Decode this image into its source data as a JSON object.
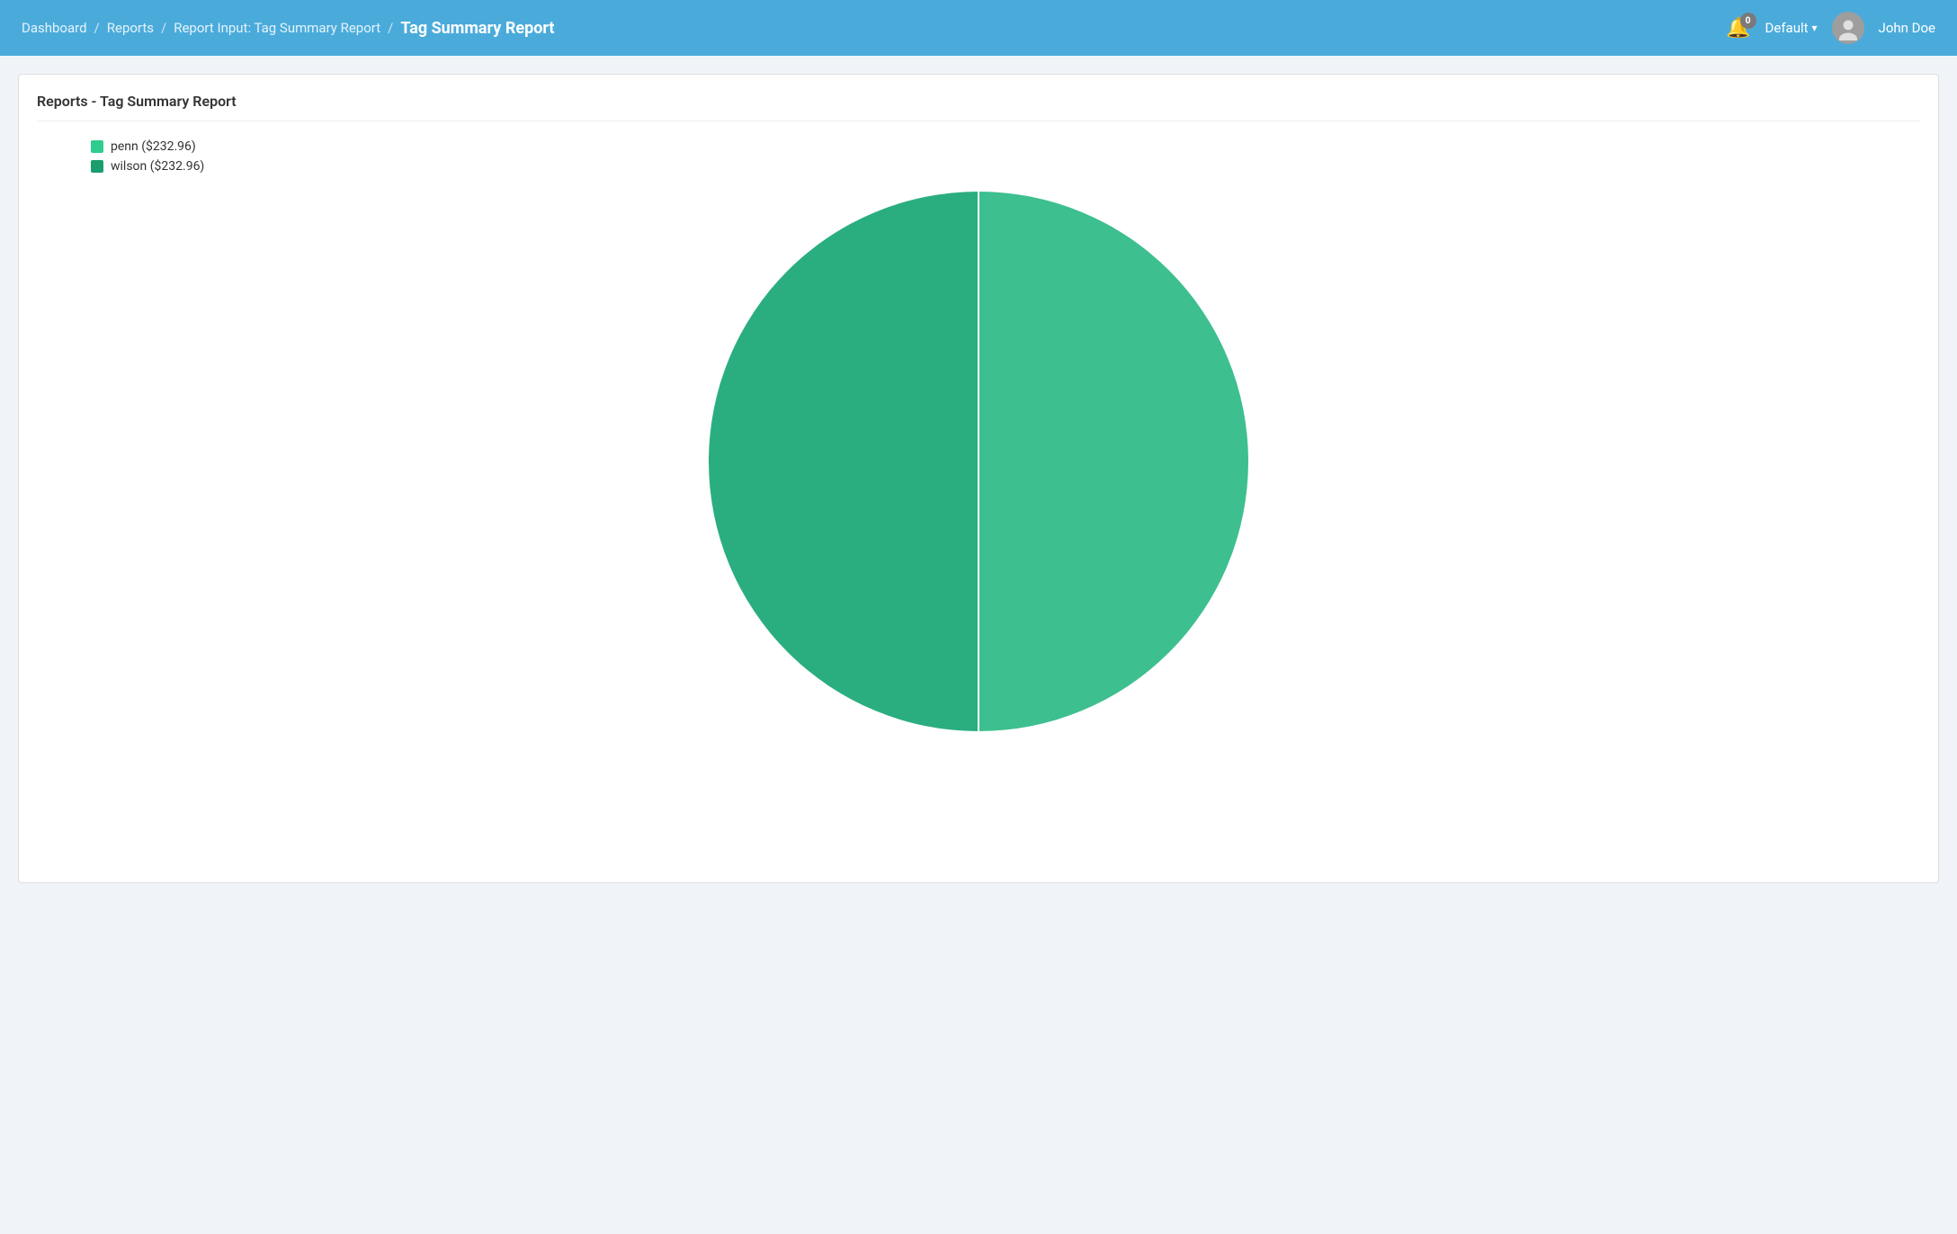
{
  "header": {
    "breadcrumb": [
      {
        "label": "Dashboard",
        "link": true
      },
      {
        "label": "Reports",
        "link": true
      },
      {
        "label": "Report Input: Tag Summary Report",
        "link": true
      }
    ],
    "current_page": "Tag Summary Report",
    "notification_count": "0",
    "dropdown_label": "Default",
    "username": "John Doe"
  },
  "report": {
    "title": "Reports - Tag Summary Report",
    "legend": [
      {
        "label": "penn ($232.96)",
        "color": "#2ecc8e"
      },
      {
        "label": "wilson ($232.96)",
        "color": "#1a9e6e"
      }
    ],
    "chart": {
      "segments": [
        {
          "name": "penn",
          "value": 232.96,
          "color": "#3dbf8f",
          "percent": 50
        },
        {
          "name": "wilson",
          "value": 232.96,
          "color": "#2aae80",
          "percent": 50
        }
      ],
      "radius": 310,
      "divider_color": "white"
    }
  }
}
